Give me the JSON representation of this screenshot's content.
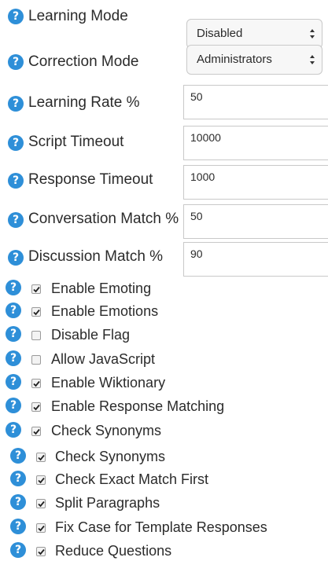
{
  "settings": {
    "learning_mode": {
      "label": "Learning Mode",
      "value": "Disabled"
    },
    "correction_mode": {
      "label": "Correction Mode",
      "value": "Administrators"
    },
    "learning_rate": {
      "label": "Learning Rate %",
      "value": "50"
    },
    "script_timeout": {
      "label": "Script Timeout",
      "value": "10000"
    },
    "response_timeout": {
      "label": "Response Timeout",
      "value": "1000"
    },
    "conversation_match": {
      "label": "Conversation Match %",
      "value": "50"
    },
    "discussion_match": {
      "label": "Discussion Match %",
      "value": "90"
    }
  },
  "help_icon": {
    "glyph": "?",
    "name": "help-icon",
    "color": "#2e8fd8"
  },
  "checkboxes": [
    {
      "label": "Enable Emoting",
      "checked": true
    },
    {
      "label": "Enable Emotions",
      "checked": true
    },
    {
      "label": "Disable Flag",
      "checked": false
    },
    {
      "label": "Allow JavaScript",
      "checked": false
    },
    {
      "label": "Enable Wiktionary",
      "checked": true
    },
    {
      "label": "Enable Response Matching",
      "checked": true
    },
    {
      "label": "Check Synonyms",
      "checked": true
    },
    {
      "label": "Check Synonyms",
      "checked": true
    },
    {
      "label": "Check Exact Match First",
      "checked": true
    },
    {
      "label": "Split Paragraphs",
      "checked": true
    },
    {
      "label": "Fix Case for Template Responses",
      "checked": true
    },
    {
      "label": "Reduce Questions",
      "checked": true
    }
  ]
}
